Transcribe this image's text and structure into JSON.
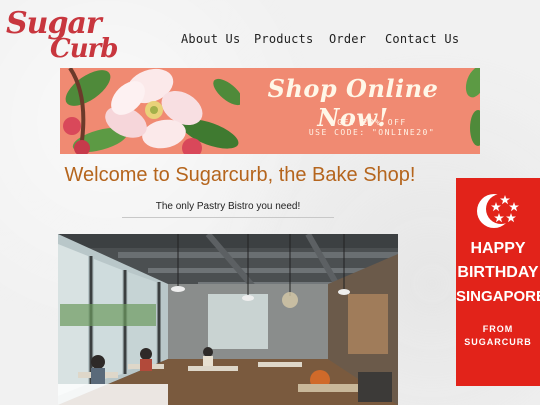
{
  "logo": {
    "line1": "Sugar",
    "line2": "Curb"
  },
  "nav": [
    {
      "label": "About Us"
    },
    {
      "label": "Products"
    },
    {
      "label": "Order"
    },
    {
      "label": "Contact Us"
    }
  ],
  "banner": {
    "headline": "Shop Online Now!",
    "promo_line1": "GET 20% OFF",
    "promo_line2": "USE CODE: \"ONLINE20\""
  },
  "main": {
    "welcome": "Welcome to Sugarcurb, the Bake Shop!",
    "tagline": "The only Pastry Bistro you need!"
  },
  "sidebar_ad": {
    "line1": "HAPPY",
    "line2": "BIRTHDAY",
    "line3": "SINGAPORE",
    "line4": "FROM",
    "line5": "SUGARCURB"
  },
  "colors": {
    "brand_red": "#c8363e",
    "banner_salmon": "#f08a72",
    "welcome_brown": "#b5651d",
    "ad_red": "#e2231a"
  }
}
